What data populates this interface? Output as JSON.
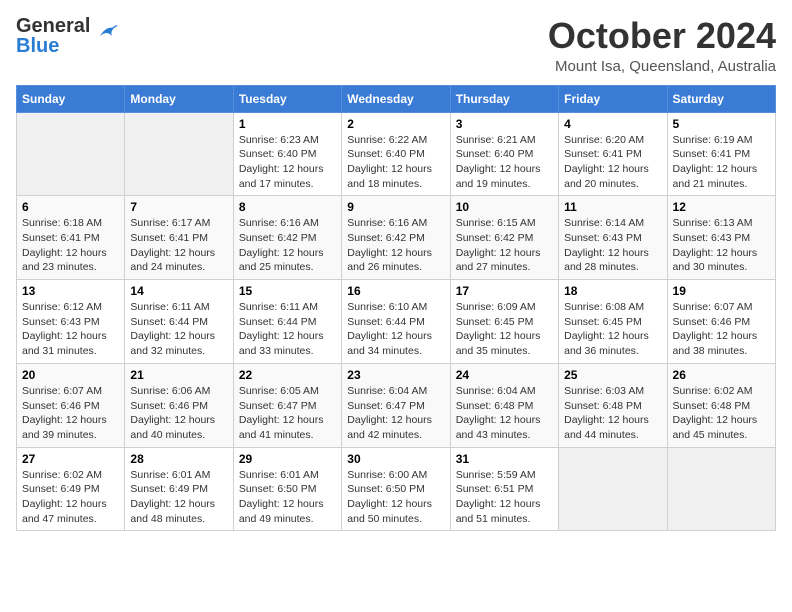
{
  "header": {
    "logo_line1": "General",
    "logo_line2": "Blue",
    "month": "October 2024",
    "location": "Mount Isa, Queensland, Australia"
  },
  "weekdays": [
    "Sunday",
    "Monday",
    "Tuesday",
    "Wednesday",
    "Thursday",
    "Friday",
    "Saturday"
  ],
  "weeks": [
    [
      {
        "day": "",
        "sunrise": "",
        "sunset": "",
        "daylight": ""
      },
      {
        "day": "",
        "sunrise": "",
        "sunset": "",
        "daylight": ""
      },
      {
        "day": "1",
        "sunrise": "Sunrise: 6:23 AM",
        "sunset": "Sunset: 6:40 PM",
        "daylight": "Daylight: 12 hours and 17 minutes."
      },
      {
        "day": "2",
        "sunrise": "Sunrise: 6:22 AM",
        "sunset": "Sunset: 6:40 PM",
        "daylight": "Daylight: 12 hours and 18 minutes."
      },
      {
        "day": "3",
        "sunrise": "Sunrise: 6:21 AM",
        "sunset": "Sunset: 6:40 PM",
        "daylight": "Daylight: 12 hours and 19 minutes."
      },
      {
        "day": "4",
        "sunrise": "Sunrise: 6:20 AM",
        "sunset": "Sunset: 6:41 PM",
        "daylight": "Daylight: 12 hours and 20 minutes."
      },
      {
        "day": "5",
        "sunrise": "Sunrise: 6:19 AM",
        "sunset": "Sunset: 6:41 PM",
        "daylight": "Daylight: 12 hours and 21 minutes."
      }
    ],
    [
      {
        "day": "6",
        "sunrise": "Sunrise: 6:18 AM",
        "sunset": "Sunset: 6:41 PM",
        "daylight": "Daylight: 12 hours and 23 minutes."
      },
      {
        "day": "7",
        "sunrise": "Sunrise: 6:17 AM",
        "sunset": "Sunset: 6:41 PM",
        "daylight": "Daylight: 12 hours and 24 minutes."
      },
      {
        "day": "8",
        "sunrise": "Sunrise: 6:16 AM",
        "sunset": "Sunset: 6:42 PM",
        "daylight": "Daylight: 12 hours and 25 minutes."
      },
      {
        "day": "9",
        "sunrise": "Sunrise: 6:16 AM",
        "sunset": "Sunset: 6:42 PM",
        "daylight": "Daylight: 12 hours and 26 minutes."
      },
      {
        "day": "10",
        "sunrise": "Sunrise: 6:15 AM",
        "sunset": "Sunset: 6:42 PM",
        "daylight": "Daylight: 12 hours and 27 minutes."
      },
      {
        "day": "11",
        "sunrise": "Sunrise: 6:14 AM",
        "sunset": "Sunset: 6:43 PM",
        "daylight": "Daylight: 12 hours and 28 minutes."
      },
      {
        "day": "12",
        "sunrise": "Sunrise: 6:13 AM",
        "sunset": "Sunset: 6:43 PM",
        "daylight": "Daylight: 12 hours and 30 minutes."
      }
    ],
    [
      {
        "day": "13",
        "sunrise": "Sunrise: 6:12 AM",
        "sunset": "Sunset: 6:43 PM",
        "daylight": "Daylight: 12 hours and 31 minutes."
      },
      {
        "day": "14",
        "sunrise": "Sunrise: 6:11 AM",
        "sunset": "Sunset: 6:44 PM",
        "daylight": "Daylight: 12 hours and 32 minutes."
      },
      {
        "day": "15",
        "sunrise": "Sunrise: 6:11 AM",
        "sunset": "Sunset: 6:44 PM",
        "daylight": "Daylight: 12 hours and 33 minutes."
      },
      {
        "day": "16",
        "sunrise": "Sunrise: 6:10 AM",
        "sunset": "Sunset: 6:44 PM",
        "daylight": "Daylight: 12 hours and 34 minutes."
      },
      {
        "day": "17",
        "sunrise": "Sunrise: 6:09 AM",
        "sunset": "Sunset: 6:45 PM",
        "daylight": "Daylight: 12 hours and 35 minutes."
      },
      {
        "day": "18",
        "sunrise": "Sunrise: 6:08 AM",
        "sunset": "Sunset: 6:45 PM",
        "daylight": "Daylight: 12 hours and 36 minutes."
      },
      {
        "day": "19",
        "sunrise": "Sunrise: 6:07 AM",
        "sunset": "Sunset: 6:46 PM",
        "daylight": "Daylight: 12 hours and 38 minutes."
      }
    ],
    [
      {
        "day": "20",
        "sunrise": "Sunrise: 6:07 AM",
        "sunset": "Sunset: 6:46 PM",
        "daylight": "Daylight: 12 hours and 39 minutes."
      },
      {
        "day": "21",
        "sunrise": "Sunrise: 6:06 AM",
        "sunset": "Sunset: 6:46 PM",
        "daylight": "Daylight: 12 hours and 40 minutes."
      },
      {
        "day": "22",
        "sunrise": "Sunrise: 6:05 AM",
        "sunset": "Sunset: 6:47 PM",
        "daylight": "Daylight: 12 hours and 41 minutes."
      },
      {
        "day": "23",
        "sunrise": "Sunrise: 6:04 AM",
        "sunset": "Sunset: 6:47 PM",
        "daylight": "Daylight: 12 hours and 42 minutes."
      },
      {
        "day": "24",
        "sunrise": "Sunrise: 6:04 AM",
        "sunset": "Sunset: 6:48 PM",
        "daylight": "Daylight: 12 hours and 43 minutes."
      },
      {
        "day": "25",
        "sunrise": "Sunrise: 6:03 AM",
        "sunset": "Sunset: 6:48 PM",
        "daylight": "Daylight: 12 hours and 44 minutes."
      },
      {
        "day": "26",
        "sunrise": "Sunrise: 6:02 AM",
        "sunset": "Sunset: 6:48 PM",
        "daylight": "Daylight: 12 hours and 45 minutes."
      }
    ],
    [
      {
        "day": "27",
        "sunrise": "Sunrise: 6:02 AM",
        "sunset": "Sunset: 6:49 PM",
        "daylight": "Daylight: 12 hours and 47 minutes."
      },
      {
        "day": "28",
        "sunrise": "Sunrise: 6:01 AM",
        "sunset": "Sunset: 6:49 PM",
        "daylight": "Daylight: 12 hours and 48 minutes."
      },
      {
        "day": "29",
        "sunrise": "Sunrise: 6:01 AM",
        "sunset": "Sunset: 6:50 PM",
        "daylight": "Daylight: 12 hours and 49 minutes."
      },
      {
        "day": "30",
        "sunrise": "Sunrise: 6:00 AM",
        "sunset": "Sunset: 6:50 PM",
        "daylight": "Daylight: 12 hours and 50 minutes."
      },
      {
        "day": "31",
        "sunrise": "Sunrise: 5:59 AM",
        "sunset": "Sunset: 6:51 PM",
        "daylight": "Daylight: 12 hours and 51 minutes."
      },
      {
        "day": "",
        "sunrise": "",
        "sunset": "",
        "daylight": ""
      },
      {
        "day": "",
        "sunrise": "",
        "sunset": "",
        "daylight": ""
      }
    ]
  ]
}
